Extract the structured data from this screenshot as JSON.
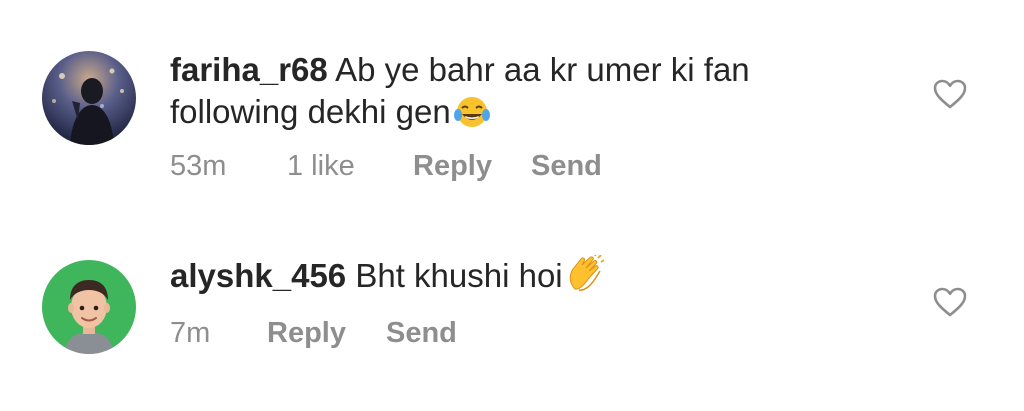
{
  "comments": [
    {
      "username": "fariha_r68",
      "text": "Ab ye bahr aa kr umer ki fan following dekhi gen",
      "emoji": "tears-of-joy-emoji",
      "time": "53m",
      "likes": "1 like",
      "reply_label": "Reply",
      "send_label": "Send"
    },
    {
      "username": "alyshk_456",
      "text": "Bht khushi hoi",
      "emoji": "clapping-hands-emoji",
      "time": "7m",
      "reply_label": "Reply",
      "send_label": "Send"
    }
  ],
  "colors": {
    "text": "#262626",
    "meta": "#8e8e8e",
    "heart": "#8e8e8e",
    "avatar_ring_green": "#3fb55c"
  }
}
